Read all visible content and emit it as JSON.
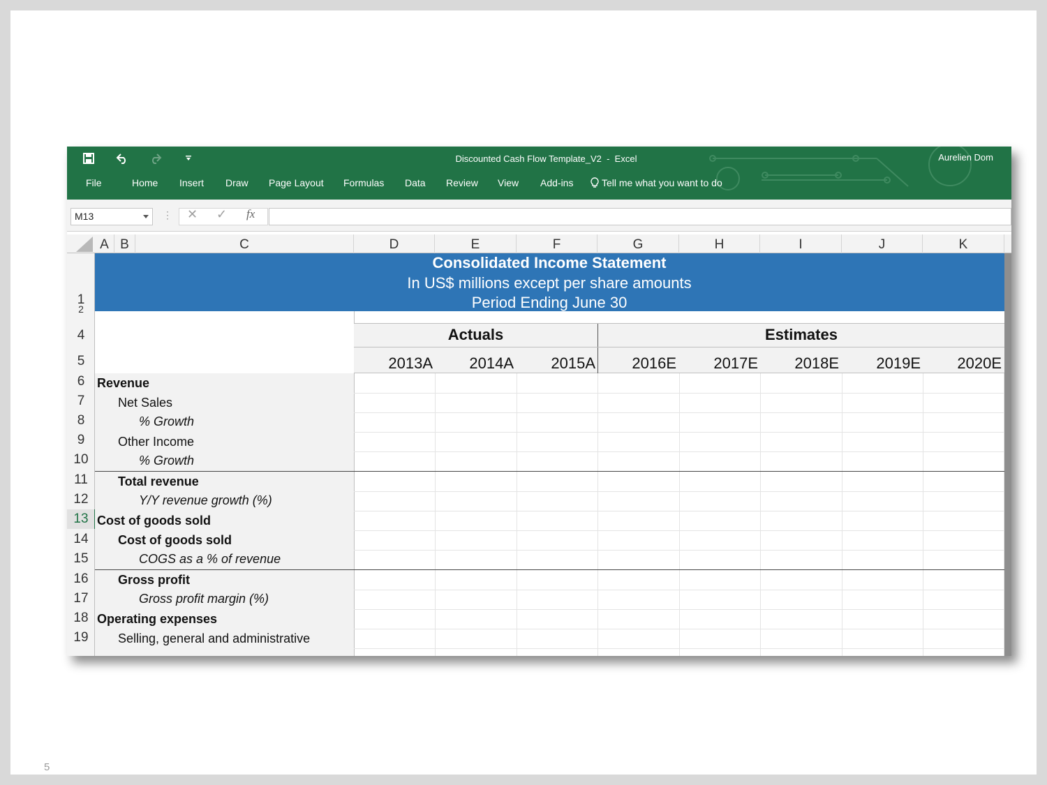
{
  "slide": {
    "page_number": "5"
  },
  "window": {
    "title": "Discounted Cash Flow Template_V2",
    "app": "Excel",
    "title_sep": "-",
    "user": "Aurelien Dom",
    "accent_color": "#217346"
  },
  "quick_access": {
    "save_icon": "save-icon",
    "undo_icon": "undo-icon",
    "redo_icon": "redo-icon",
    "customize_icon": "customize-qat-icon"
  },
  "ribbon": {
    "tabs": [
      "File",
      "Home",
      "Insert",
      "Draw",
      "Page Layout",
      "Formulas",
      "Data",
      "Review",
      "View",
      "Add-ins"
    ],
    "tell_me": "Tell me what you want to do"
  },
  "formula_bar": {
    "name_box": "M13",
    "cancel_icon": "cancel-icon",
    "enter_icon": "enter-icon",
    "fx_label": "fx",
    "value": ""
  },
  "columns": [
    "A",
    "B",
    "C",
    "D",
    "E",
    "F",
    "G",
    "H",
    "I",
    "J",
    "K"
  ],
  "rows": [
    "1",
    "2",
    "4",
    "5",
    "6",
    "7",
    "8",
    "9",
    "10",
    "11",
    "12",
    "13",
    "14",
    "15",
    "16",
    "17",
    "18",
    "19"
  ],
  "active_row": "13",
  "sheet": {
    "header": {
      "title": "Consolidated Income Statement",
      "subtitle": "In US$ millions except per share amounts",
      "period": "Period Ending June 30",
      "band_color": "#2e75b6"
    },
    "groups": {
      "actuals": "Actuals",
      "estimates": "Estimates"
    },
    "years": [
      "2013A",
      "2014A",
      "2015A",
      "2016E",
      "2017E",
      "2018E",
      "2019E",
      "2020E"
    ],
    "line_items": [
      {
        "row": "6",
        "label": "Revenue",
        "style": "bold",
        "indent": 0
      },
      {
        "row": "7",
        "label": "Net Sales",
        "style": "normal",
        "indent": 1
      },
      {
        "row": "8",
        "label": "% Growth",
        "style": "italic",
        "indent": 2
      },
      {
        "row": "9",
        "label": "Other Income",
        "style": "normal",
        "indent": 1
      },
      {
        "row": "10",
        "label": "% Growth",
        "style": "italic",
        "indent": 2
      },
      {
        "row": "11",
        "label": "Total revenue",
        "style": "bold",
        "indent": 1
      },
      {
        "row": "12",
        "label": "Y/Y revenue growth (%)",
        "style": "italic",
        "indent": 2
      },
      {
        "row": "13",
        "label": "Cost of goods sold",
        "style": "bold",
        "indent": 0
      },
      {
        "row": "14",
        "label": "Cost of goods sold",
        "style": "bold",
        "indent": 1
      },
      {
        "row": "15",
        "label": "COGS as a % of revenue",
        "style": "italic",
        "indent": 2
      },
      {
        "row": "16",
        "label": "Gross profit",
        "style": "bold",
        "indent": 1
      },
      {
        "row": "17",
        "label": "Gross profit margin (%)",
        "style": "italic",
        "indent": 2
      },
      {
        "row": "18",
        "label": "Operating expenses",
        "style": "bold",
        "indent": 0
      },
      {
        "row": "19",
        "label": "Selling, general and administrative",
        "style": "normal",
        "indent": 1
      }
    ]
  }
}
